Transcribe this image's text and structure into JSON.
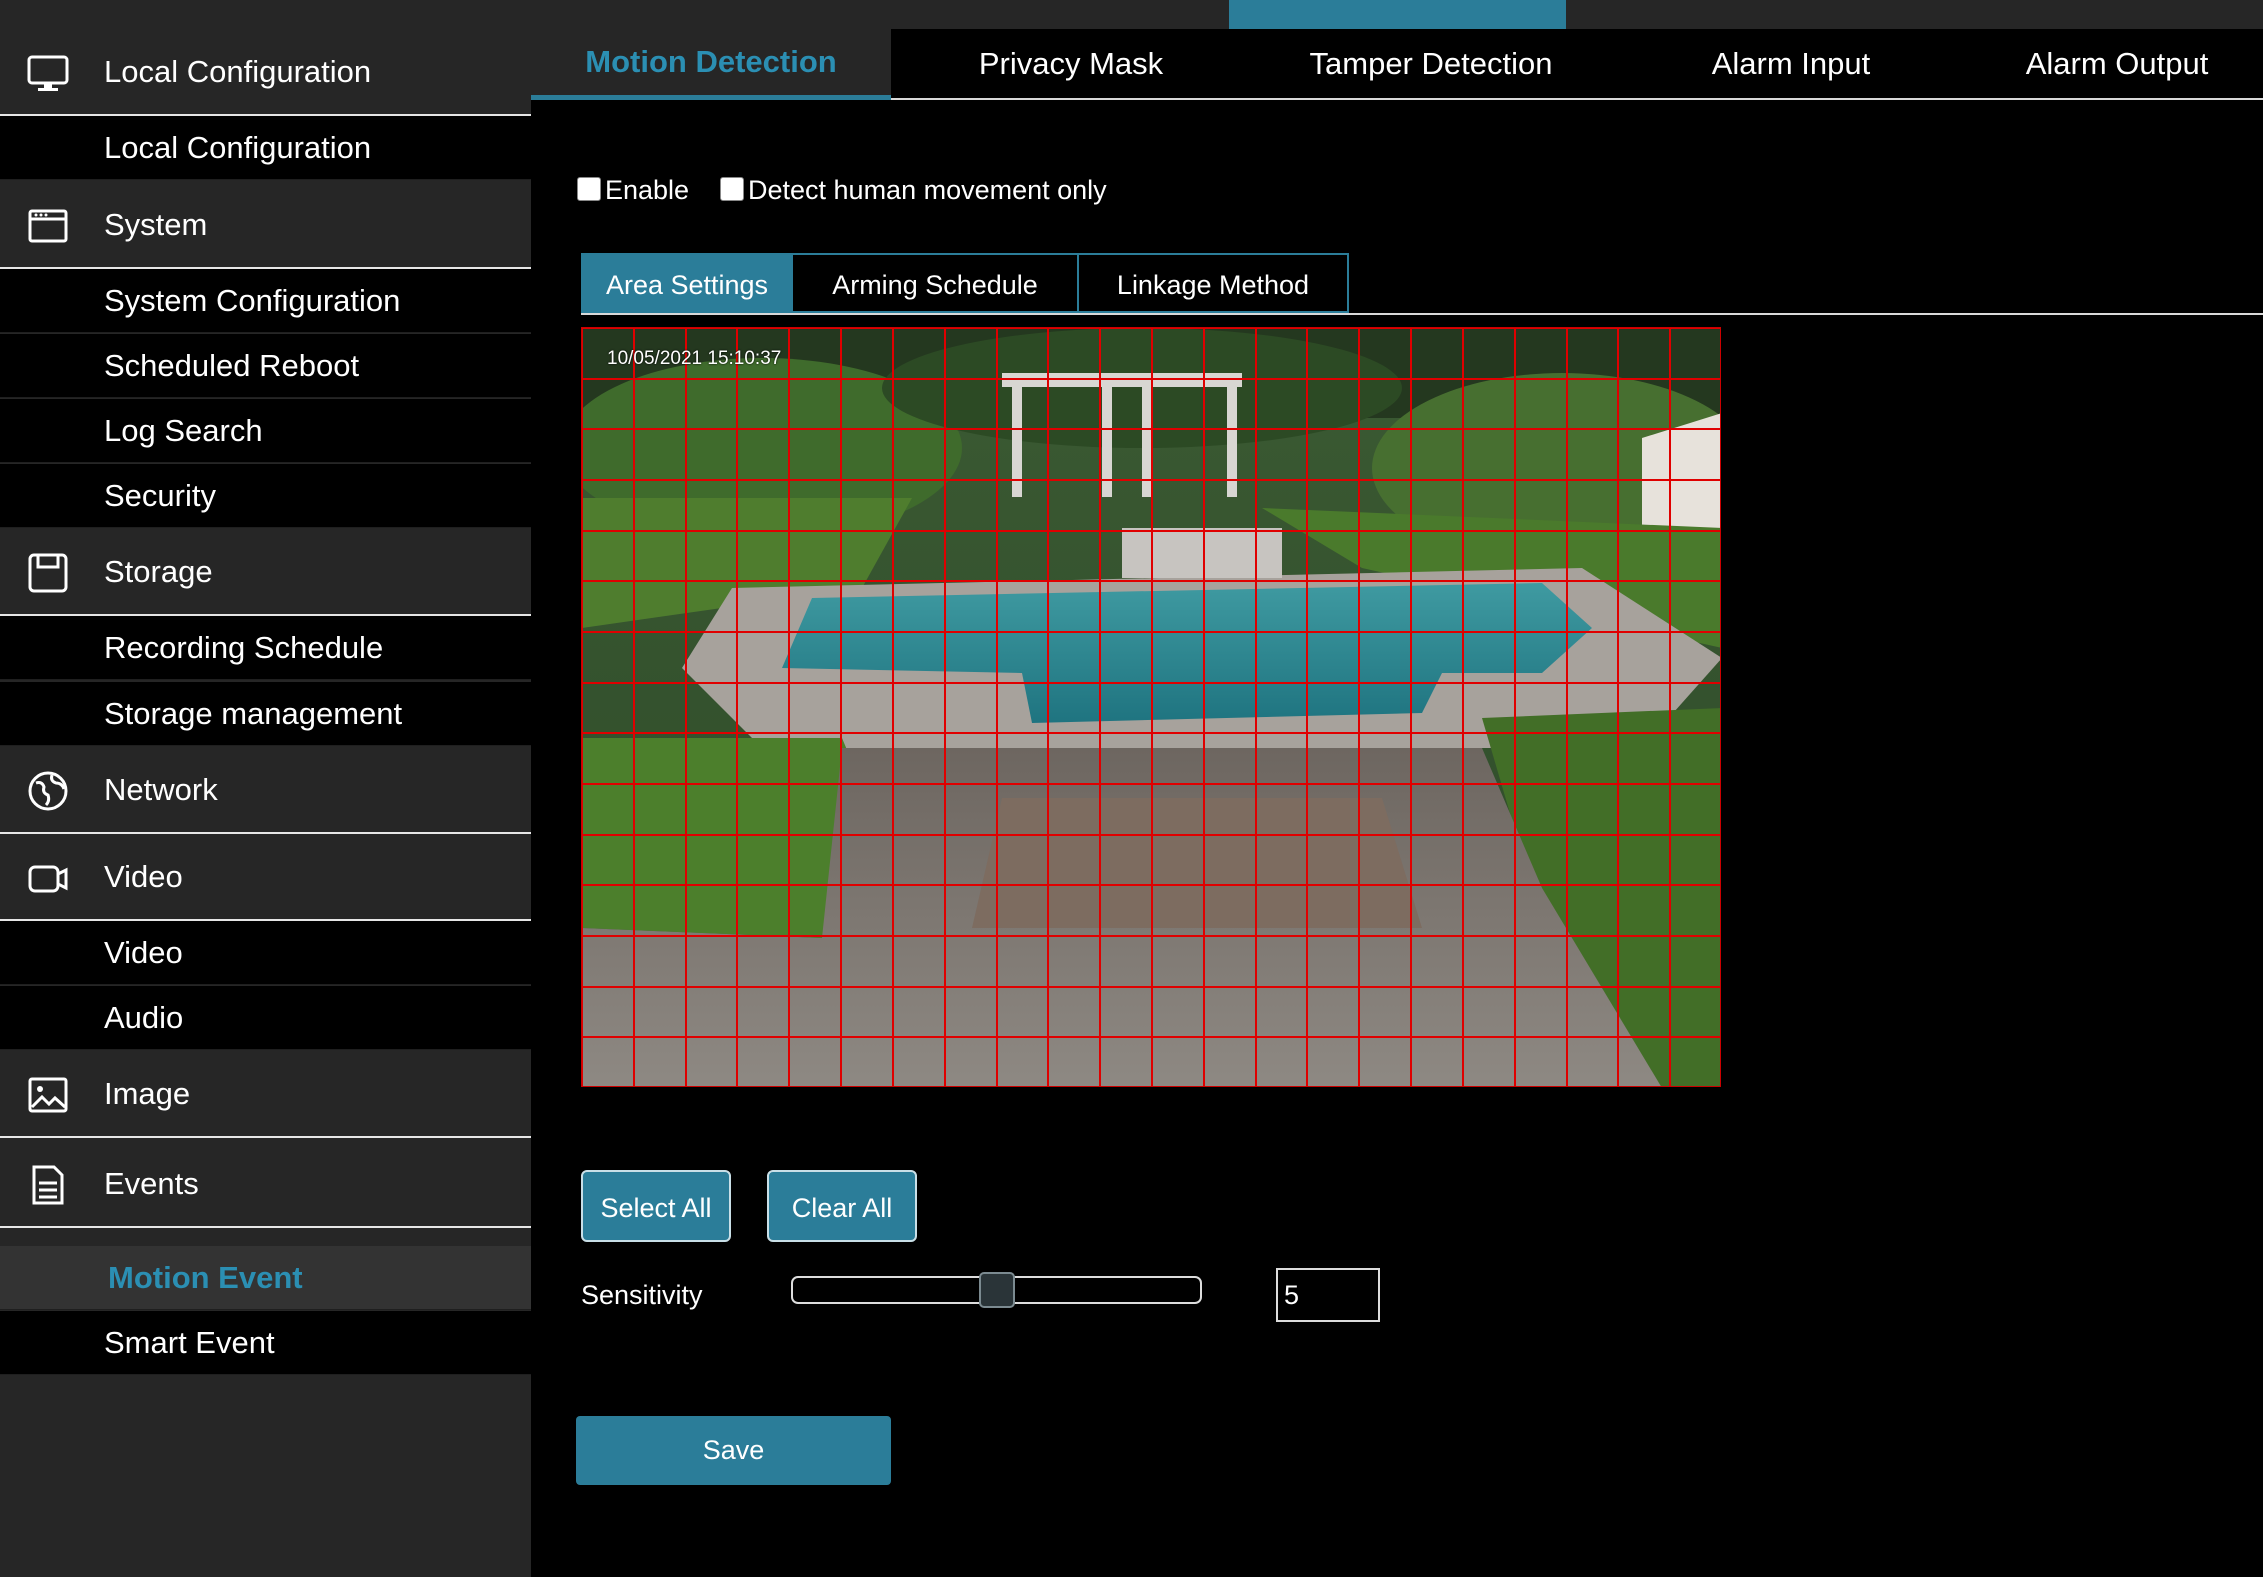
{
  "sidebar": {
    "local_config": {
      "label": "Local Configuration",
      "icon": "monitor-icon"
    },
    "local_config_item": "Local Configuration",
    "system": {
      "label": "System",
      "icon": "window-icon"
    },
    "system_items": [
      "System Configuration",
      "Scheduled Reboot",
      "Log Search",
      "Security"
    ],
    "storage": {
      "label": "Storage",
      "icon": "floppy-disk-icon"
    },
    "storage_items": [
      "Recording Schedule",
      "Storage management"
    ],
    "network": {
      "label": "Network",
      "icon": "globe-icon"
    },
    "video": {
      "label": "Video",
      "icon": "camera-icon"
    },
    "video_items": [
      "Video",
      "Audio"
    ],
    "image": {
      "label": "Image",
      "icon": "picture-icon"
    },
    "events": {
      "label": "Events",
      "icon": "document-icon"
    },
    "events_items": [
      "Motion Event",
      "Smart Event"
    ],
    "active_item": "Motion Event"
  },
  "tabs": [
    "Motion Detection",
    "Privacy Mask",
    "Tamper Detection",
    "Alarm Input",
    "Alarm Output"
  ],
  "active_tab": "Motion Detection",
  "options": {
    "enable": {
      "label": "Enable",
      "checked": false
    },
    "human_only": {
      "label": "Detect human movement only",
      "checked": false
    }
  },
  "subtabs": [
    "Area Settings",
    "Arming Schedule",
    "Linkage Method"
  ],
  "active_subtab": "Area Settings",
  "preview": {
    "timestamp": "10/05/2021  15:10:37",
    "grid_color": "#e00000",
    "grid_rows": 15,
    "grid_cols": 22
  },
  "buttons": {
    "select_all": "Select All",
    "clear_all": "Clear All",
    "save": "Save"
  },
  "sensitivity": {
    "label": "Sensitivity",
    "value": "5",
    "min": 0,
    "max": 10
  },
  "colors": {
    "accent": "#2b7d99",
    "accent_text": "#2b8fb3",
    "sidebar_bg": "#262626"
  }
}
